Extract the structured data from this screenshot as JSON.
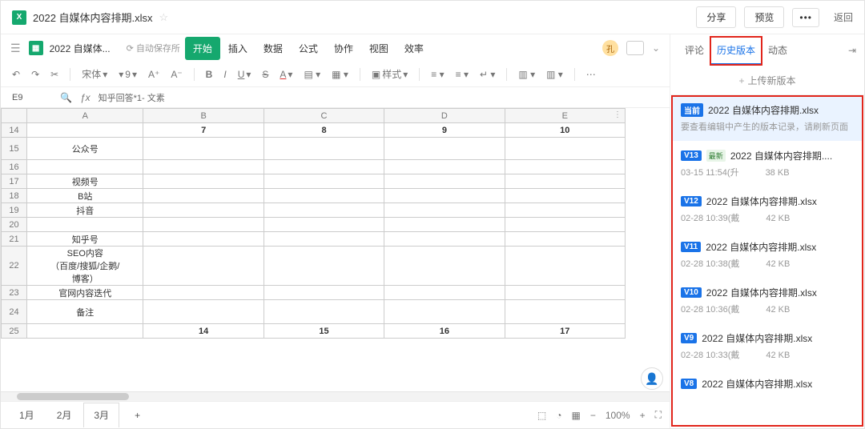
{
  "titlebar": {
    "filename": "2022 自媒体内容排期.xlsx",
    "share": "分享",
    "preview": "预览",
    "back": "返回"
  },
  "menubar": {
    "doc_tab": "2022 自媒体...",
    "auto_save": "自动保存所",
    "items": [
      "开始",
      "插入",
      "数据",
      "公式",
      "协作",
      "视图",
      "效率"
    ],
    "avatar": "孔"
  },
  "toolbar": {
    "font": "宋体",
    "size": "9",
    "style_lbl": "样式"
  },
  "formula": {
    "cell": "E9",
    "text": "知乎回答*1- 文素"
  },
  "grid": {
    "cols": [
      "A",
      "B",
      "C",
      "D",
      "E"
    ],
    "rows": [
      {
        "n": "14",
        "cells": [
          "",
          "7",
          "8",
          "9",
          "10"
        ],
        "header": true
      },
      {
        "n": "15",
        "cells": [
          "公众号",
          "",
          "",
          "",
          ""
        ]
      },
      {
        "n": "16",
        "cells": [
          "",
          "",
          "",
          "",
          ""
        ]
      },
      {
        "n": "17",
        "cells": [
          "视频号",
          "",
          "",
          "",
          ""
        ]
      },
      {
        "n": "18",
        "cells": [
          "B站",
          "",
          "",
          "",
          ""
        ]
      },
      {
        "n": "19",
        "cells": [
          "抖音",
          "",
          "",
          "",
          ""
        ]
      },
      {
        "n": "20",
        "cells": [
          "",
          "",
          "",
          "",
          ""
        ]
      },
      {
        "n": "21",
        "cells": [
          "知乎号",
          "",
          "",
          "",
          ""
        ]
      },
      {
        "n": "22",
        "cells": [
          "SEO内容\n（百度/搜狐/企鹅/\n博客）",
          "",
          "",
          "",
          ""
        ],
        "tall": true
      },
      {
        "n": "23",
        "cells": [
          "官网内容迭代",
          "",
          "",
          "",
          ""
        ]
      },
      {
        "n": "24",
        "cells": [
          "备注",
          "",
          "",
          "",
          ""
        ],
        "med": true
      },
      {
        "n": "25",
        "cells": [
          "",
          "14",
          "15",
          "16",
          "17"
        ],
        "header": true
      }
    ]
  },
  "sheetbar": {
    "tabs": [
      "1月",
      "2月",
      "3月"
    ],
    "active": 2,
    "zoom": "100%"
  },
  "right": {
    "tabs": [
      "评论",
      "历史版本",
      "动态"
    ],
    "active": 1,
    "upload": "上传新版本",
    "items": [
      {
        "badge": "当前",
        "badge_type": "cur",
        "name": "2022 自媒体内容排期.xlsx",
        "sub": "要查看编辑中产生的版本记录，请刷新页面",
        "current": true
      },
      {
        "badge": "V13",
        "tag": "最新",
        "name": "2022 自媒体内容排期....",
        "sub": "03-15 11:54(升　　　38 KB"
      },
      {
        "badge": "V12",
        "name": "2022 自媒体内容排期.xlsx",
        "sub": "02-28 10:39(戴　　　42 KB"
      },
      {
        "badge": "V11",
        "name": "2022 自媒体内容排期.xlsx",
        "sub": "02-28 10:38(戴　　　42 KB"
      },
      {
        "badge": "V10",
        "name": "2022 自媒体内容排期.xlsx",
        "sub": "02-28 10:36(戴　　　42 KB"
      },
      {
        "badge": "V9",
        "name": "2022 自媒体内容排期.xlsx",
        "sub": "02-28 10:33(戴　　　42 KB"
      },
      {
        "badge": "V8",
        "name": "2022 自媒体内容排期.xlsx",
        "sub": ""
      }
    ]
  }
}
